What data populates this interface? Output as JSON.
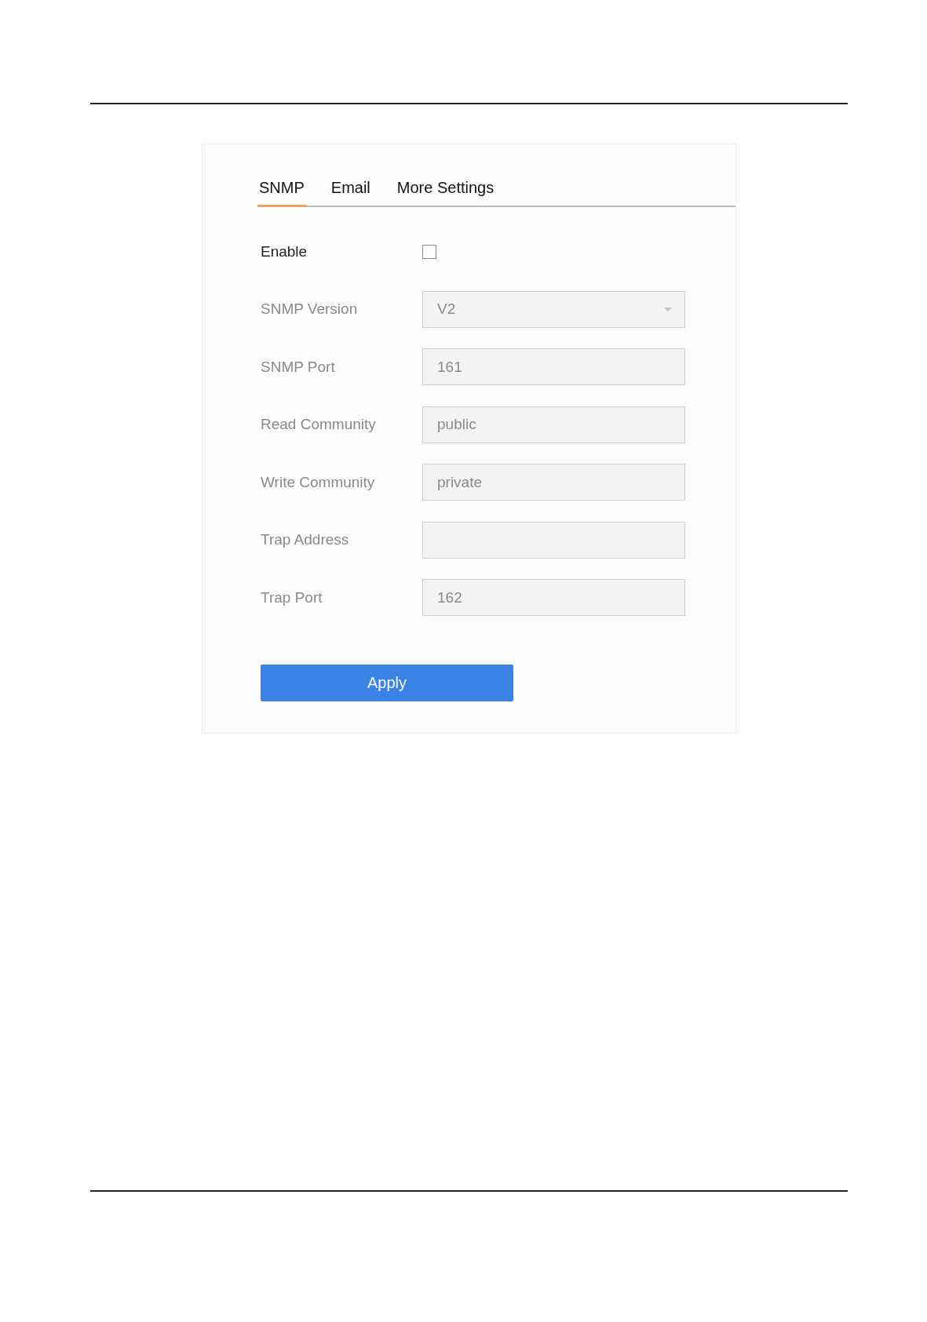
{
  "tabs": [
    {
      "label": "SNMP",
      "selected": true
    },
    {
      "label": "Email",
      "selected": false
    },
    {
      "label": "More Settings",
      "selected": false
    }
  ],
  "rows": [
    {
      "kind": "checkbox",
      "label": "Enable",
      "disabled": false,
      "checked": false
    },
    {
      "kind": "select",
      "label": "SNMP Version",
      "disabled": true,
      "value": "V2"
    },
    {
      "kind": "text",
      "label": "SNMP Port",
      "disabled": true,
      "value": "161"
    },
    {
      "kind": "text",
      "label": "Read Community",
      "disabled": true,
      "value": "public"
    },
    {
      "kind": "text",
      "label": "Write Community",
      "disabled": true,
      "value": "private"
    },
    {
      "kind": "text",
      "label": "Trap Address",
      "disabled": true
    },
    {
      "kind": "text",
      "label": "Trap Port",
      "disabled": true,
      "value": "162"
    }
  ],
  "apply_button": "Apply"
}
